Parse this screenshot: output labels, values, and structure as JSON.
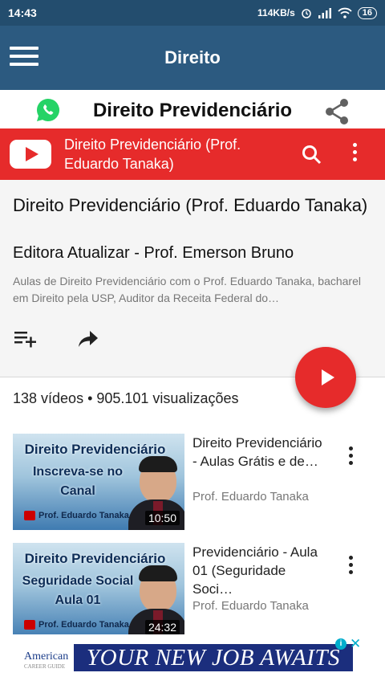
{
  "status": {
    "time": "14:43",
    "speed": "114KB/s",
    "battery": "16"
  },
  "appbar": {
    "title": "Direito"
  },
  "page": {
    "title": "Direito Previdenciário"
  },
  "youtube": {
    "title": "Direito Previdenciário (Prof. Eduardo Tanaka)"
  },
  "playlist": {
    "title": "Direito Previdenciário (Prof. Eduardo Tanaka)",
    "channel": "Editora Atualizar - Prof. Emerson Bruno",
    "description": "Aulas de Direito Previdenciário com o Prof. Eduardo Tanaka, bacharel em Direito pela USP, Auditor da Receita Federal do…",
    "stats": "138 vídeos • 905.101 visualizações"
  },
  "videos": [
    {
      "title": "Direito Previdenciário - Aulas Grátis e de…",
      "channel": "Prof. Eduardo Tanaka",
      "duration": "10:50",
      "thumb_line1": "Direito Previdenciário",
      "thumb_line2": "Inscreva-se no Canal",
      "thumb_brand": "Prof. Eduardo Tanaka"
    },
    {
      "title": "Previdenciário - Aula 01 (Seguridade Soci…",
      "channel": "Prof. Eduardo Tanaka",
      "duration": "24:32",
      "thumb_line1": "Direito Previdenciário",
      "thumb_line2": "Seguridade Social Aula 01",
      "thumb_brand": "Prof. Eduardo Tanaka"
    }
  ],
  "ad": {
    "brand": "American",
    "brand_sub": "CAREER GUIDE",
    "banner": "YOUR NEW JOB AWAITS"
  },
  "colors": {
    "appbar": "#2c5a80",
    "statusbar": "#234d6e",
    "youtube_red": "#e62b2b",
    "whatsapp": "#25d366"
  }
}
